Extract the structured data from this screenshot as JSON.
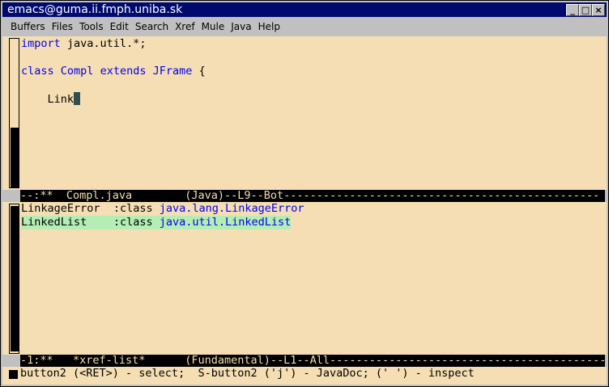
{
  "window": {
    "title": "emacs@guma.ii.fmph.uniba.sk",
    "buttons": [
      "_",
      "□",
      "×"
    ]
  },
  "menu": {
    "items": [
      "Buffers",
      "Files",
      "Tools",
      "Edit",
      "Search",
      "Xref",
      "Mule",
      "Java",
      "Help"
    ]
  },
  "editor": {
    "lines": [
      {
        "kw": "import",
        "rest": " java.util.*;"
      },
      {
        "kw": "",
        "rest": ""
      },
      {
        "kw": "class",
        "rest": " ",
        "kw2": "Compl",
        "kw3": "extends",
        "kw4": "JFrame",
        "tail": " {"
      },
      {
        "kw": "",
        "rest": ""
      },
      {
        "kw": "",
        "rest": "    Link"
      }
    ]
  },
  "modeline1": {
    "text": "--:**  Compl.java        (Java)--L9--Bot------------------------------------------------"
  },
  "xref_list": {
    "rows": [
      {
        "name": "LinkageError",
        "kind": ":class",
        "fqn": "java.lang.LinkageError"
      },
      {
        "name": "LinkedList  ",
        "kind": ":class",
        "fqn": "java.util.LinkedList"
      }
    ]
  },
  "modeline2": {
    "text": "-1:**   *xref-list*      (Fundamental)--L1--All------------------------------------------"
  },
  "echo": {
    "text": "button2 (<RET>) - select;  S-button2 ('j') - JavaDoc; (' ') - inspect"
  }
}
